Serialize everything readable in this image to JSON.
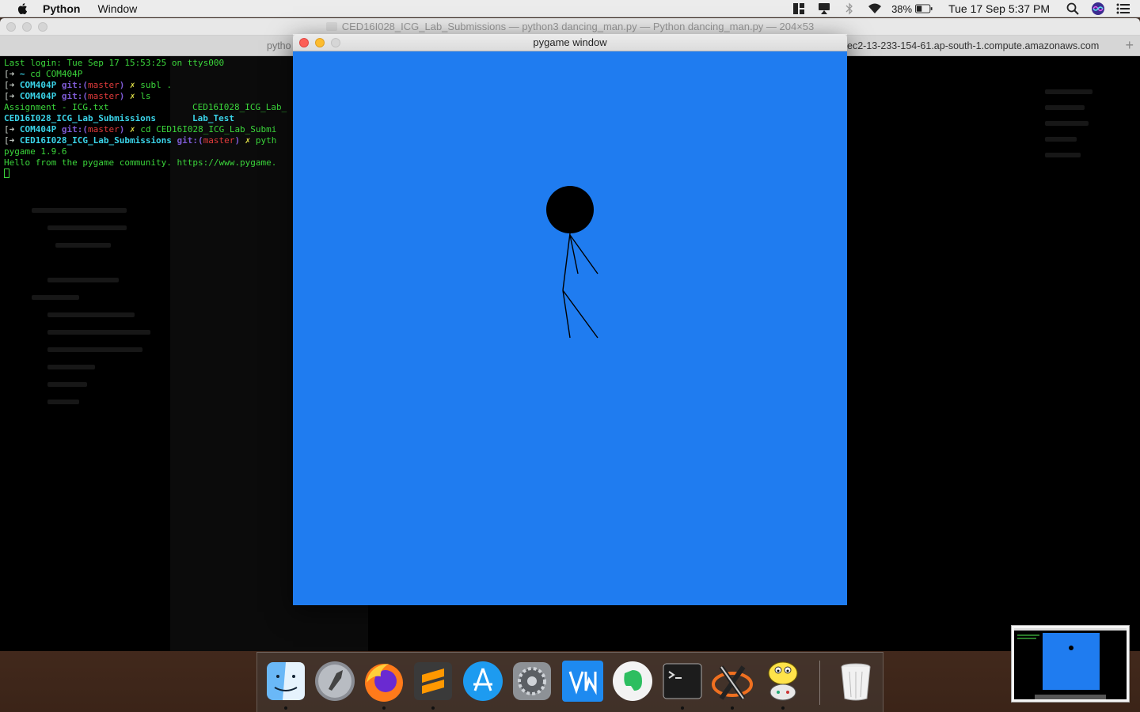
{
  "menubar": {
    "app_name": "Python",
    "menu_items": [
      "Window"
    ],
    "battery": "38%",
    "clock": "Tue 17 Sep  5:37 PM"
  },
  "terminal": {
    "title": "CED16I028_ICG_Lab_Submissions — python3 dancing_man.py — Python dancing_man.py — 204×53",
    "tab_left": "pytho",
    "tab_right": "ec2-13-233-154-61.ap-south-1.compute.amazonaws.com",
    "lines": {
      "l1": "Last login: Tue Sep 17 15:53:25 on ttys000",
      "l2_arrow": "[➜ ",
      "l2_dir": "~",
      "l2_cmd": " cd COM404P",
      "l3_dir": "COM404P",
      "l3_git": " git:(",
      "l3_branch": "master",
      "l3_close": ")",
      "l3_mark": " ✗",
      "l3_cmd": " subl .",
      "l4_cmd": " ls",
      "l5a": "Assignment - ICG.txt",
      "l5b": "CED16I028_ICG_Lab_",
      "l6a": "CED16I028_ICG_Lab_Submissions",
      "l6b": "Lab_Test",
      "l7_cmd": " cd CED16I028_ICG_Lab_Submi",
      "l8_dir": "CED16I028_ICG_Lab_Submissions",
      "l8_cmd": " pyth",
      "l9": "pygame 1.9.6",
      "l10": "Hello from the pygame community. https://www.pygame."
    }
  },
  "pygame_window": {
    "title": "pygame window",
    "background_color": "#1f7cf0",
    "figure_color": "#000000"
  },
  "dock": {
    "items": [
      "finder-icon",
      "launchpad-icon",
      "firefox-icon",
      "sublime-text-icon",
      "app-store-icon",
      "system-preferences-icon",
      "vnc-viewer-icon",
      "evernote-icon",
      "terminal-icon",
      "xquartz-icon",
      "python-launcher-icon",
      "trash-icon"
    ]
  }
}
